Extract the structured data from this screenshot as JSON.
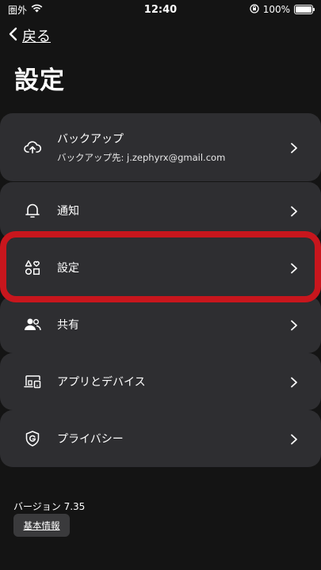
{
  "status_bar": {
    "carrier": "圏外",
    "time": "12:40",
    "battery": "100%",
    "battery_level": 1.0
  },
  "nav": {
    "back_label": "戻る"
  },
  "page": {
    "title": "設定"
  },
  "menu": {
    "items": [
      {
        "icon": "cloud-upload-icon",
        "label": "バックアップ",
        "sub": "バックアップ先: j.zephyrx@gmail.com"
      },
      {
        "icon": "bell-icon",
        "label": "通知"
      },
      {
        "icon": "shapes-icon",
        "label": "設定"
      },
      {
        "icon": "people-icon",
        "label": "共有"
      },
      {
        "icon": "devices-icon",
        "label": "アプリとデバイス"
      },
      {
        "icon": "shield-g-icon",
        "label": "プライバシー"
      }
    ]
  },
  "footer": {
    "version": "バージョン 7.35",
    "info_button": "基本情報"
  },
  "colors": {
    "background": "#141414",
    "card": "#2e2e31",
    "highlight": "#c8161d"
  }
}
